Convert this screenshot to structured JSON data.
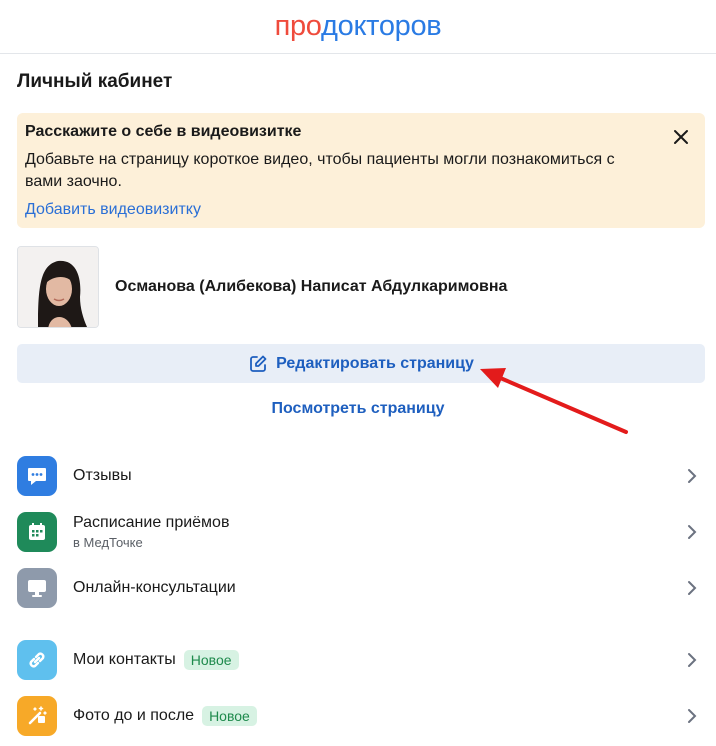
{
  "logo": {
    "part1": "про",
    "part2": "докторов",
    "color1": "#ef4b3c",
    "color2": "#2a7be4"
  },
  "page_title": "Личный кабинет",
  "banner": {
    "title": "Расскажите о себе в видеовизитке",
    "text": "Добавьте на страницу короткое видео, чтобы пациенты могли познакомиться с вами заочно.",
    "link": "Добавить видеовизитку",
    "close_icon": "close-icon"
  },
  "doctor": {
    "name": "Османова (Алибекова) Написат Абдулкаримовна"
  },
  "edit_button": {
    "label": "Редактировать страницу",
    "icon": "edit-icon"
  },
  "view_link": "Посмотреть страницу",
  "menu": [
    {
      "label": "Отзывы",
      "icon": "chat-icon",
      "color": "#2f7de1"
    },
    {
      "label": "Расписание приёмов",
      "sub": "в МедТочке",
      "icon": "calendar-icon",
      "color": "#1f8a5a"
    },
    {
      "label": "Онлайн-консультации",
      "icon": "monitor-icon",
      "color": "#8e9aab"
    },
    {
      "label": "Мои контакты",
      "badge": "Новое",
      "icon": "link-icon",
      "color": "#5fc0ee"
    },
    {
      "label": "Фото до и после",
      "badge": "Новое",
      "icon": "magic-wand-icon",
      "color": "#f7a928"
    }
  ],
  "annotation": {
    "icon": "red-arrow-icon",
    "color": "#e31b1b"
  }
}
